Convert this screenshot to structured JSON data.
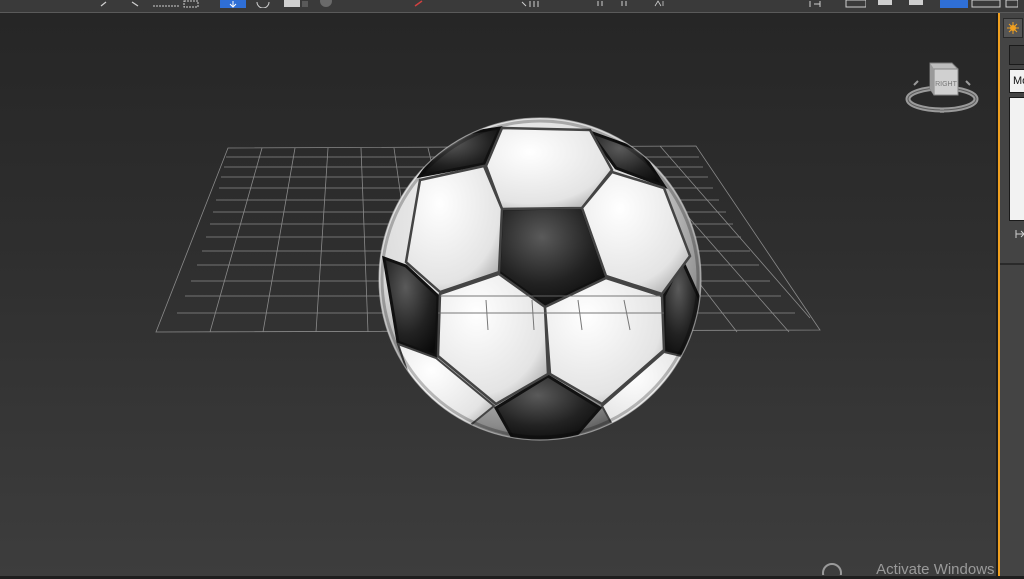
{
  "toolbar": {
    "icons": [
      "undo-icon",
      "redo-icon",
      "select-region-icon",
      "select-move-icon",
      "select-rotate-icon",
      "select-scale-icon",
      "snap-icon",
      "mirror-icon",
      "align-icon",
      "layer-icon",
      "render-icon"
    ]
  },
  "viewport": {
    "background_top": "#262626",
    "background_bottom": "#3d3d3d",
    "active_border_color": "#f0a020",
    "grid_color": "#9a9a9a",
    "object": "soccer-ball"
  },
  "viewcube": {
    "face_label": "RIGHT"
  },
  "command_panel": {
    "dropdown_text": "Mo"
  },
  "watermark": {
    "text": "Activate Windows"
  }
}
